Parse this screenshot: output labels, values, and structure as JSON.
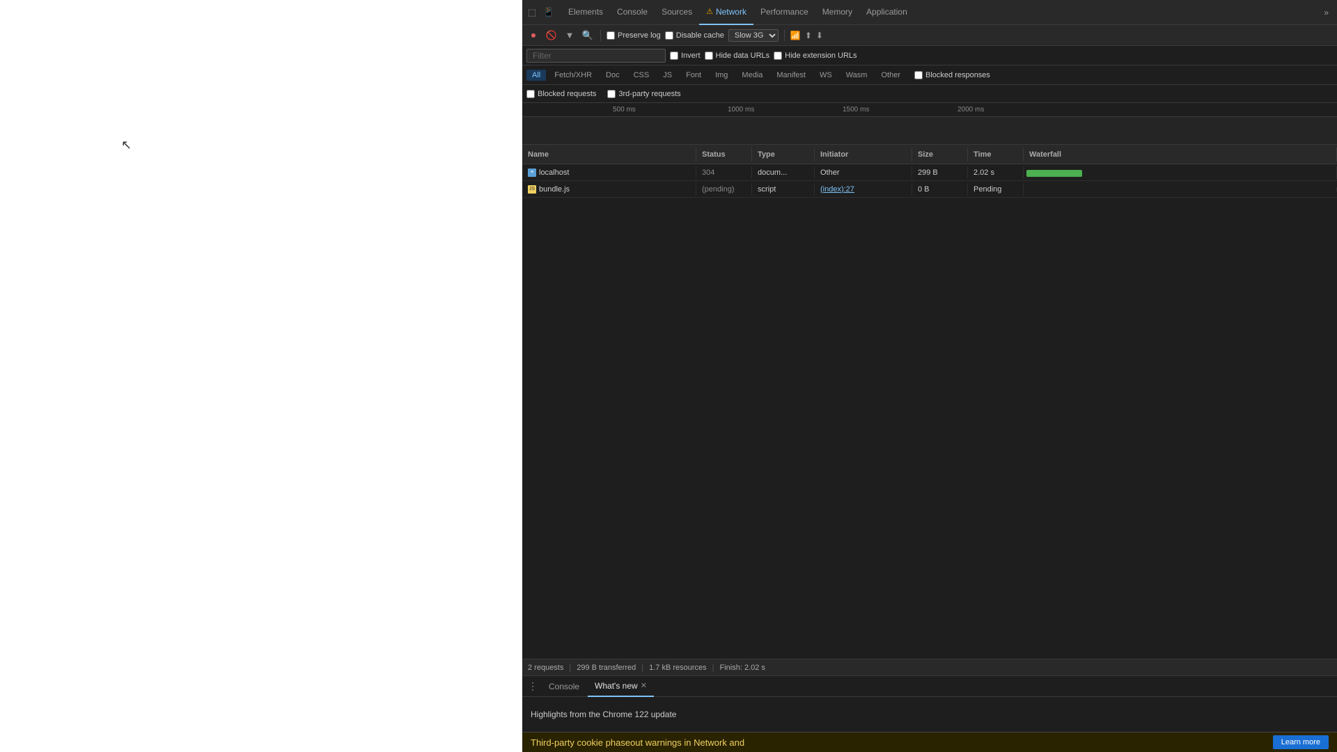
{
  "page": {
    "background": "#ffffff"
  },
  "devtools": {
    "tabs": [
      {
        "label": "Elements",
        "active": false
      },
      {
        "label": "Console",
        "active": false
      },
      {
        "label": "Sources",
        "active": false
      },
      {
        "label": "Network",
        "active": true,
        "warning": true
      },
      {
        "label": "Performance",
        "active": false
      },
      {
        "label": "Memory",
        "active": false
      },
      {
        "label": "Application",
        "active": false
      }
    ],
    "toolbar": {
      "preserve_log_label": "Preserve log",
      "disable_cache_label": "Disable cache",
      "throttle_value": "Slow 3G"
    },
    "filter": {
      "placeholder": "Filter",
      "invert_label": "Invert",
      "hide_data_urls_label": "Hide data URLs",
      "hide_extension_urls_label": "Hide extension URLs"
    },
    "type_filters": [
      "All",
      "Fetch/XHR",
      "Doc",
      "CSS",
      "JS",
      "Font",
      "Img",
      "Media",
      "Manifest",
      "WS",
      "Wasm",
      "Other"
    ],
    "active_type": "All",
    "blocked_row": {
      "blocked_requests_label": "Blocked requests",
      "third_party_label": "3rd-party requests"
    },
    "timeline": {
      "marks": [
        "500 ms",
        "1000 ms",
        "1500 ms",
        "2000 ms"
      ]
    },
    "table": {
      "columns": [
        "Name",
        "Status",
        "Type",
        "Initiator",
        "Size",
        "Time",
        "Waterfall"
      ],
      "rows": [
        {
          "name": "localhost",
          "icon": "doc",
          "status": "304",
          "type": "docum...",
          "initiator": "Other",
          "initiator_link": false,
          "size": "299 B",
          "time": "2.02 s",
          "has_waterfall": true
        },
        {
          "name": "bundle.js",
          "icon": "js",
          "status": "(pending)",
          "type": "script",
          "initiator": "(index):27",
          "initiator_link": true,
          "size": "0 B",
          "time": "Pending",
          "has_waterfall": false
        }
      ]
    },
    "statusbar": {
      "requests": "2 requests",
      "transferred": "299 B transferred",
      "resources": "1.7 kB resources",
      "finish": "Finish: 2.02 s"
    },
    "console": {
      "tab_console_label": "Console",
      "tab_whatsnew_label": "What's new",
      "highlights_text": "Highlights from the Chrome 122 update",
      "bottom_text": "Third-party cookie phaseout warnings in Network and",
      "bottom_btn_label": "Learn more"
    }
  }
}
